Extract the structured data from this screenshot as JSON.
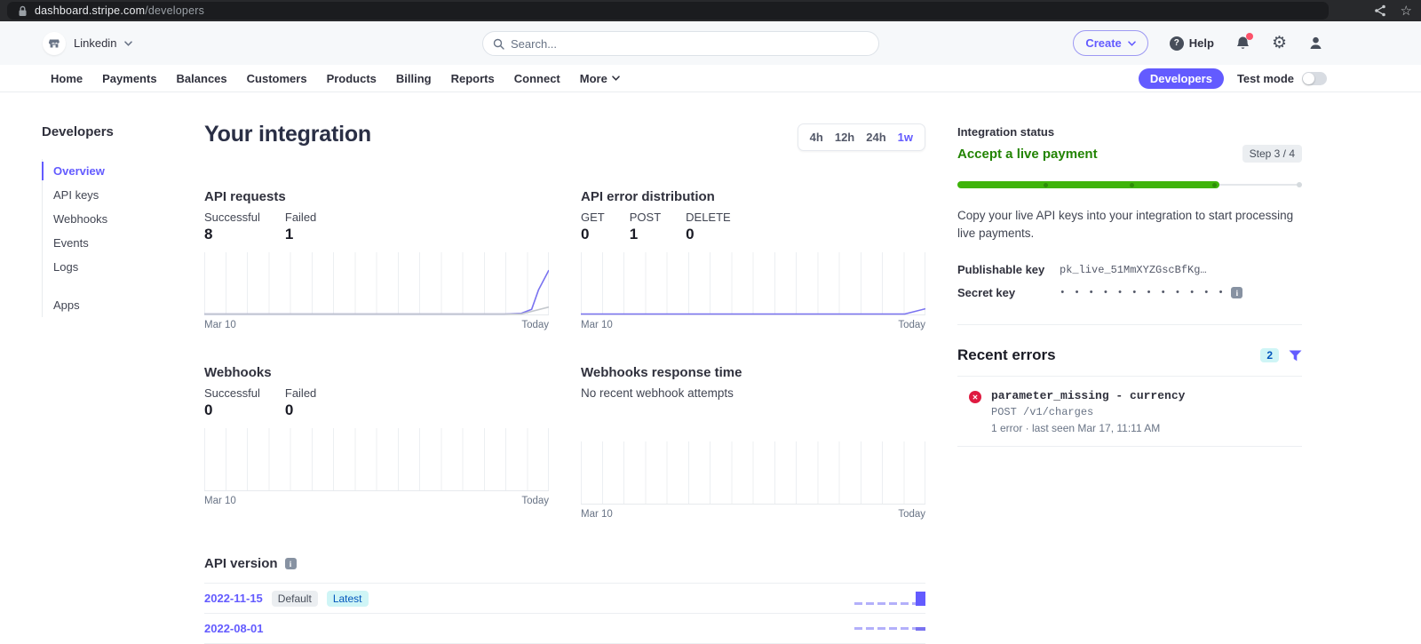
{
  "browser": {
    "url_host": "dashboard.stripe.com",
    "url_path": "/developers"
  },
  "header": {
    "account_name": "Linkedin",
    "search_placeholder": "Search...",
    "create_label": "Create",
    "help_label": "Help"
  },
  "nav": {
    "items": [
      "Home",
      "Payments",
      "Balances",
      "Customers",
      "Products",
      "Billing",
      "Reports",
      "Connect"
    ],
    "more_label": "More",
    "developers_label": "Developers",
    "test_mode_label": "Test mode",
    "test_mode_on": false
  },
  "sidebar": {
    "title": "Developers",
    "items": [
      {
        "label": "Overview",
        "active": true
      },
      {
        "label": "API keys",
        "active": false
      },
      {
        "label": "Webhooks",
        "active": false
      },
      {
        "label": "Events",
        "active": false
      },
      {
        "label": "Logs",
        "active": false
      }
    ],
    "apps_label": "Apps"
  },
  "main": {
    "title": "Your integration",
    "range_options": [
      "4h",
      "12h",
      "24h",
      "1w"
    ],
    "range_selected": "1w",
    "charts": [
      {
        "title": "API requests",
        "stats": [
          {
            "label": "Successful",
            "value": "8"
          },
          {
            "label": "Failed",
            "value": "1"
          }
        ],
        "x_start": "Mar 10",
        "x_end": "Today",
        "series": [
          {
            "name": "successful",
            "color": "#7a73f0",
            "points": [
              [
                0,
                0
              ],
              [
                87,
                0
              ],
              [
                92,
                1
              ],
              [
                95,
                8
              ],
              [
                97,
                42
              ],
              [
                100,
                76
              ]
            ]
          },
          {
            "name": "failed",
            "color": "#c3c7cc",
            "points": [
              [
                0,
                0
              ],
              [
                92,
                0
              ],
              [
                100,
                12
              ]
            ]
          }
        ]
      },
      {
        "title": "API error distribution",
        "stats": [
          {
            "label": "GET",
            "value": "0"
          },
          {
            "label": "POST",
            "value": "1"
          },
          {
            "label": "DELETE",
            "value": "0"
          }
        ],
        "x_start": "Mar 10",
        "x_end": "Today",
        "series": [
          {
            "name": "post-errors",
            "color": "#7a73f0",
            "points": [
              [
                0,
                0
              ],
              [
                94,
                0
              ],
              [
                100,
                9
              ]
            ]
          }
        ]
      },
      {
        "title": "Webhooks",
        "stats": [
          {
            "label": "Successful",
            "value": "0"
          },
          {
            "label": "Failed",
            "value": "0"
          }
        ],
        "x_start": "Mar 10",
        "x_end": "Today",
        "series": []
      },
      {
        "title": "Webhooks response time",
        "empty_label": "No recent webhook attempts",
        "x_start": "Mar 10",
        "x_end": "Today",
        "series": []
      }
    ],
    "api_version": {
      "title": "API version",
      "rows": [
        {
          "version": "2022-11-15",
          "badges": [
            {
              "label": "Default",
              "style": "gray"
            },
            {
              "label": "Latest",
              "style": "cyan"
            }
          ],
          "spark_end": "tall"
        },
        {
          "version": "2022-08-01",
          "badges": [],
          "spark_end": "short"
        }
      ]
    }
  },
  "integration_status": {
    "label": "Integration status",
    "title": "Accept a live payment",
    "step": "Step 3 / 4",
    "progress_pct": 76,
    "description": "Copy your live API keys into your integration to start processing live payments.",
    "keys": [
      {
        "label": "Publishable key",
        "value": "pk_live_51MmXYZGscBfKg…",
        "masked": false
      },
      {
        "label": "Secret key",
        "value": "• • • • • • • • • • • •",
        "masked": true
      }
    ]
  },
  "recent_errors": {
    "title": "Recent errors",
    "count": "2",
    "items": [
      {
        "name": "parameter_missing - currency",
        "endpoint": "POST /v1/charges",
        "meta": "1 error · last seen Mar 17, 11:11 AM"
      }
    ]
  },
  "colors": {
    "accent": "#635bff",
    "success_text": "#228403",
    "progress_green": "#3fb40b",
    "cyan_badge_bg": "#cff5f6",
    "cyan_badge_text": "#0055bc",
    "error_red": "#df1b41",
    "chart_line": "#7a73f0"
  }
}
